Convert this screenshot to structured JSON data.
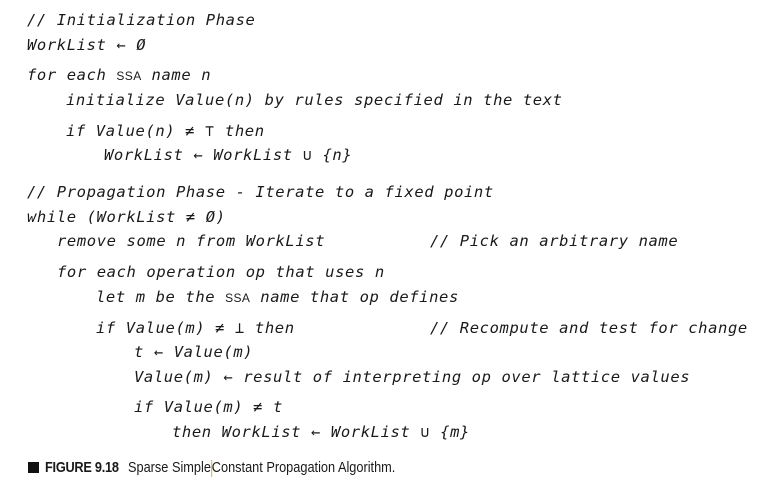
{
  "algorithm": {
    "lines": [
      {
        "text": "// Initialization Phase"
      },
      {
        "text": "WorkList ← Ø"
      },
      {
        "pre": "for each ",
        "sc": "SSA",
        "post": " name n"
      },
      {
        "text": "initialize Value(n) by rules specified in the text"
      },
      {
        "text": "if Value(n) ≠ ⊤ then"
      },
      {
        "text": "WorkList ← WorkList ∪ {n}"
      },
      {
        "text": "// Propagation Phase - Iterate to a fixed point"
      },
      {
        "text": "while (WorkList ≠ Ø)"
      },
      {
        "text": "remove some n from WorkList"
      },
      {
        "text": "for each operation op that uses n"
      },
      {
        "pre": "let m be the ",
        "sc": "SSA",
        "post": " name that op defines"
      },
      {
        "text": "if Value(m) ≠ ⊥ then"
      },
      {
        "text": "t ← Value(m)"
      },
      {
        "text": "Value(m) ← result of interpreting op over lattice values"
      },
      {
        "text": "if Value(m) ≠ t"
      },
      {
        "text": "then WorkList ← WorkList ∪ {m}"
      }
    ],
    "comments": {
      "pick": "// Pick an arbitrary name",
      "recompute": "// Recompute and test for change"
    }
  },
  "caption": {
    "label": "FIGURE 9.18",
    "text_before_cursor": "Sparse Simple",
    "text_after_cursor": "Constant Propagation Algorithm."
  }
}
